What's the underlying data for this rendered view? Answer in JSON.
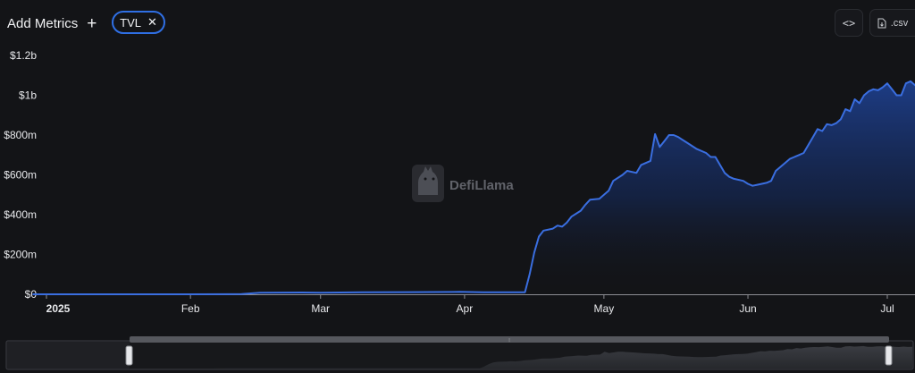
{
  "toolbar": {
    "add_metrics_label": "Add Metrics",
    "add_icon": "plus-icon",
    "metric_chip_label": "TVL",
    "metric_chip_close_icon": "close-icon",
    "embed_icon": "code-brackets-icon",
    "csv_label": ".csv",
    "csv_icon": "file-download-icon"
  },
  "watermark": {
    "text": "DefiLlama",
    "icon": "llama-logo-icon"
  },
  "colors": {
    "background": "#131417",
    "line": "#3a6ee0",
    "area_top": "#1e3f8c",
    "accent_border": "#2f6fe4"
  },
  "chart_data": {
    "type": "area",
    "title": "",
    "xlabel": "",
    "ylabel": "",
    "ylim": [
      0,
      1200000000
    ],
    "y_ticks": [
      "$0",
      "$200m",
      "$400m",
      "$600m",
      "$800m",
      "$1b",
      "$1.2b"
    ],
    "x_ticks": [
      "2025",
      "Feb",
      "Mar",
      "Apr",
      "May",
      "Jun",
      "Jul"
    ],
    "x_tick_dates": [
      "2025-01-01",
      "2025-02-01",
      "2025-03-01",
      "2025-04-01",
      "2025-05-01",
      "2025-06-01",
      "2025-07-01"
    ],
    "x_range": [
      "2024-12-29",
      "2025-07-06"
    ],
    "grid": false,
    "legend": "none",
    "series": [
      {
        "name": "TVL",
        "points": [
          [
            "2024-12-29",
            0
          ],
          [
            "2025-01-15",
            0
          ],
          [
            "2025-02-01",
            0
          ],
          [
            "2025-02-12",
            1000000
          ],
          [
            "2025-02-16",
            8000000
          ],
          [
            "2025-02-25",
            9000000
          ],
          [
            "2025-03-01",
            8000000
          ],
          [
            "2025-03-10",
            10000000
          ],
          [
            "2025-03-20",
            11000000
          ],
          [
            "2025-03-31",
            12000000
          ],
          [
            "2025-04-05",
            10000000
          ],
          [
            "2025-04-14",
            10000000
          ],
          [
            "2025-04-15",
            100000000
          ],
          [
            "2025-04-16",
            210000000
          ],
          [
            "2025-04-17",
            290000000
          ],
          [
            "2025-04-18",
            320000000
          ],
          [
            "2025-04-20",
            330000000
          ],
          [
            "2025-04-21",
            345000000
          ],
          [
            "2025-04-22",
            340000000
          ],
          [
            "2025-04-23",
            360000000
          ],
          [
            "2025-04-24",
            390000000
          ],
          [
            "2025-04-26",
            420000000
          ],
          [
            "2025-04-27",
            450000000
          ],
          [
            "2025-04-28",
            475000000
          ],
          [
            "2025-04-30",
            480000000
          ],
          [
            "2025-05-02",
            520000000
          ],
          [
            "2025-05-03",
            570000000
          ],
          [
            "2025-05-05",
            600000000
          ],
          [
            "2025-05-06",
            620000000
          ],
          [
            "2025-05-08",
            610000000
          ],
          [
            "2025-05-09",
            650000000
          ],
          [
            "2025-05-11",
            670000000
          ],
          [
            "2025-05-12",
            805000000
          ],
          [
            "2025-05-13",
            740000000
          ],
          [
            "2025-05-14",
            770000000
          ],
          [
            "2025-05-15",
            800000000
          ],
          [
            "2025-05-16",
            800000000
          ],
          [
            "2025-05-17",
            790000000
          ],
          [
            "2025-05-19",
            760000000
          ],
          [
            "2025-05-21",
            730000000
          ],
          [
            "2025-05-23",
            710000000
          ],
          [
            "2025-05-24",
            690000000
          ],
          [
            "2025-05-25",
            690000000
          ],
          [
            "2025-05-26",
            650000000
          ],
          [
            "2025-05-27",
            610000000
          ],
          [
            "2025-05-28",
            590000000
          ],
          [
            "2025-05-29",
            580000000
          ],
          [
            "2025-05-31",
            570000000
          ],
          [
            "2025-06-01",
            555000000
          ],
          [
            "2025-06-02",
            545000000
          ],
          [
            "2025-06-03",
            550000000
          ],
          [
            "2025-06-05",
            560000000
          ],
          [
            "2025-06-06",
            570000000
          ],
          [
            "2025-06-07",
            620000000
          ],
          [
            "2025-06-08",
            640000000
          ],
          [
            "2025-06-10",
            680000000
          ],
          [
            "2025-06-11",
            690000000
          ],
          [
            "2025-06-12",
            700000000
          ],
          [
            "2025-06-13",
            710000000
          ],
          [
            "2025-06-14",
            750000000
          ],
          [
            "2025-06-15",
            790000000
          ],
          [
            "2025-06-16",
            830000000
          ],
          [
            "2025-06-17",
            820000000
          ],
          [
            "2025-06-18",
            855000000
          ],
          [
            "2025-06-19",
            850000000
          ],
          [
            "2025-06-20",
            860000000
          ],
          [
            "2025-06-21",
            880000000
          ],
          [
            "2025-06-22",
            930000000
          ],
          [
            "2025-06-23",
            920000000
          ],
          [
            "2025-06-24",
            980000000
          ],
          [
            "2025-06-25",
            960000000
          ],
          [
            "2025-06-26",
            1000000000
          ],
          [
            "2025-06-27",
            1020000000
          ],
          [
            "2025-06-28",
            1030000000
          ],
          [
            "2025-06-29",
            1025000000
          ],
          [
            "2025-06-30",
            1040000000
          ],
          [
            "2025-07-01",
            1060000000
          ],
          [
            "2025-07-02",
            1030000000
          ],
          [
            "2025-07-03",
            1000000000
          ],
          [
            "2025-07-04",
            1000000000
          ],
          [
            "2025-07-05",
            1060000000
          ],
          [
            "2025-07-06",
            1070000000
          ],
          [
            "2025-07-07",
            1050000000
          ],
          [
            "2025-07-08",
            1060000000
          ],
          [
            "2025-07-09",
            1075000000
          ],
          [
            "2025-07-10",
            1040000000
          ],
          [
            "2025-07-11",
            1040000000
          ],
          [
            "2025-07-12",
            1060000000
          ],
          [
            "2025-07-13",
            1065000000
          ],
          [
            "2025-07-14",
            1050000000
          ],
          [
            "2025-07-15",
            1075000000
          ],
          [
            "2025-07-16",
            1040000000
          ],
          [
            "2025-07-17",
            1030000000
          ],
          [
            "2025-07-18",
            1050000000
          ],
          [
            "2025-07-19",
            1035000000
          ],
          [
            "2025-07-20",
            1040000000
          ]
        ]
      }
    ],
    "zoom_slider": {
      "window_start": "2025-01-01",
      "window_end": "2025-07-01",
      "handle_glyph": "⦙"
    }
  }
}
